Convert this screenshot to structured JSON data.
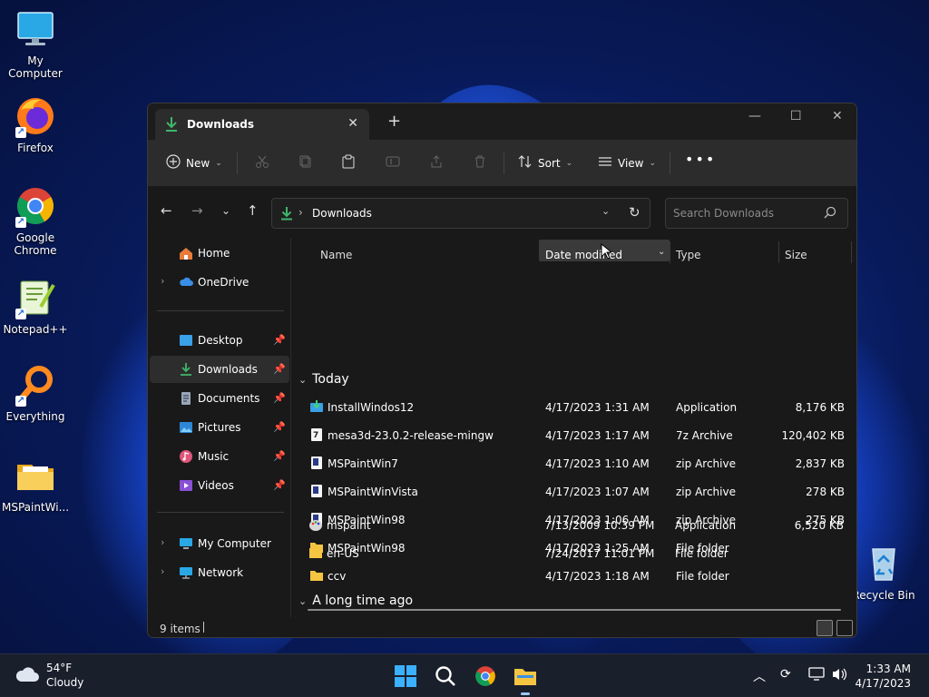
{
  "desktop": {
    "icons": [
      {
        "label": "My Computer"
      },
      {
        "label": "Firefox"
      },
      {
        "label": "Google Chrome"
      },
      {
        "label": "Notepad++"
      },
      {
        "label": "Everything"
      },
      {
        "label": "MSPaintWi..."
      },
      {
        "label": "Recycle Bin"
      }
    ]
  },
  "window": {
    "tab_label": "Downloads",
    "toolbar": {
      "new_label": "New",
      "sort_label": "Sort",
      "view_label": "View"
    },
    "address": {
      "separator": "›",
      "location": "Downloads"
    },
    "search": {
      "placeholder": "Search Downloads"
    },
    "nav": {
      "home": "Home",
      "onedrive": "OneDrive",
      "desktop": "Desktop",
      "downloads": "Downloads",
      "documents": "Documents",
      "pictures": "Pictures",
      "music": "Music",
      "videos": "Videos",
      "my_computer": "My Computer",
      "network": "Network"
    },
    "columns": {
      "name": "Name",
      "date": "Date modified",
      "type": "Type",
      "size": "Size"
    },
    "groups": {
      "today": "Today",
      "old": "A long time ago"
    },
    "files": [
      {
        "name": "InstallWindos12",
        "date": "4/17/2023 1:31 AM",
        "type": "Application",
        "size": "8,176 KB"
      },
      {
        "name": "mesa3d-23.0.2-release-mingw",
        "date": "4/17/2023 1:17 AM",
        "type": "7z Archive",
        "size": "120,402 KB"
      },
      {
        "name": "MSPaintWin7",
        "date": "4/17/2023 1:10 AM",
        "type": "zip Archive",
        "size": "2,837 KB"
      },
      {
        "name": "MSPaintWinVista",
        "date": "4/17/2023 1:07 AM",
        "type": "zip Archive",
        "size": "278 KB"
      },
      {
        "name": "MSPaintWin98",
        "date": "4/17/2023 1:06 AM",
        "type": "zip Archive",
        "size": "275 KB"
      },
      {
        "name": "MSPaintWin98",
        "date": "4/17/2023 1:25 AM",
        "type": "File folder",
        "size": ""
      },
      {
        "name": "ccv",
        "date": "4/17/2023 1:18 AM",
        "type": "File folder",
        "size": ""
      },
      {
        "name": "mspaint",
        "date": "7/13/2009 10:39 PM",
        "type": "Application",
        "size": "6,520 KB"
      },
      {
        "name": "en-US",
        "date": "7/24/2017 11:01 PM",
        "type": "File folder",
        "size": ""
      }
    ],
    "status": {
      "count": "9 items"
    }
  },
  "taskbar": {
    "weather_temp": "54°F",
    "weather_desc": "Cloudy",
    "time": "1:33 AM",
    "date": "4/17/2023"
  },
  "colors": {
    "accent_folder": "#f5c542",
    "download_green": "#3fb66b",
    "window_bg": "#202020"
  }
}
